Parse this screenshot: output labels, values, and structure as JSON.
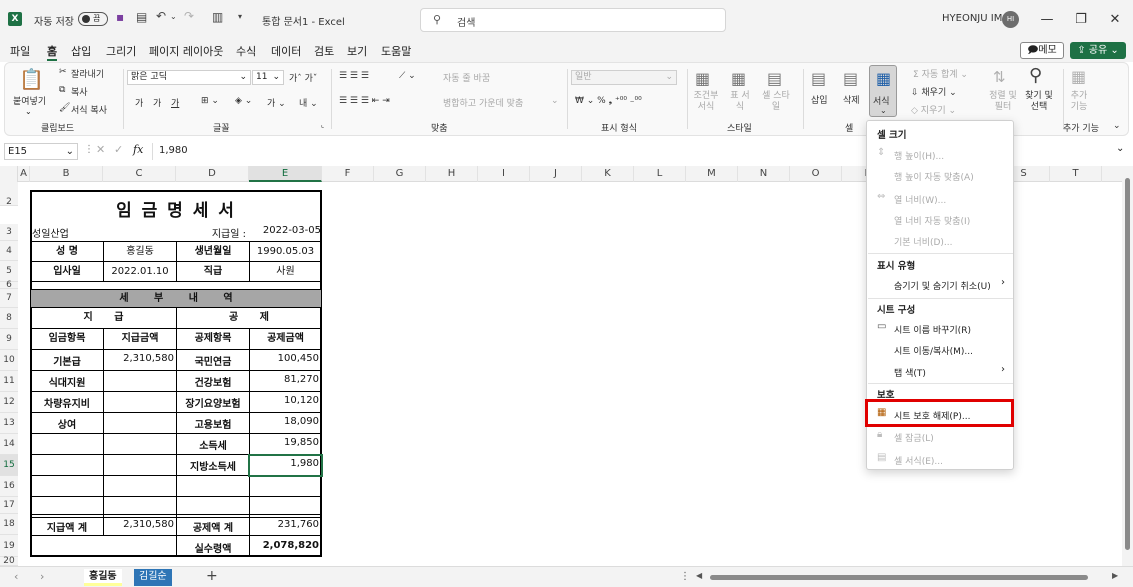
{
  "titlebar": {
    "autosave_label": "자동 저장",
    "autosave_state": "끔",
    "doc_title": "통합 문서1 - Excel",
    "search_placeholder": "검색",
    "user_name": "HYEONJU IM",
    "user_initials": "HI"
  },
  "menu": {
    "tabs": [
      "파일",
      "홈",
      "삽입",
      "그리기",
      "페이지 레이아웃",
      "수식",
      "데이터",
      "검토",
      "보기",
      "도움말"
    ],
    "active_index": 1,
    "memo_label": "메모",
    "share_label": "공유"
  },
  "ribbon": {
    "paste": "붙여넣기",
    "cut": "잘라내기",
    "copy": "복사",
    "format_painter": "서식 복사",
    "clipboard_group": "클립보드",
    "font_name": "맑은 고딕",
    "font_size": "11",
    "font_group": "글꼴",
    "wrap_text": "자동 줄 바꿈",
    "merge_center": "병합하고 가운데 맞춤",
    "align_group": "맞춤",
    "number_format": "일반",
    "number_group": "표시 형식",
    "conditional_format": "조건부 서식",
    "format_table": "표 서식",
    "cell_styles": "셀 스타일",
    "styles_group": "스타일",
    "insert": "삽입",
    "delete": "삭제",
    "format": "서식",
    "cells_group": "셀",
    "autosum": "자동 합계",
    "fill": "채우기",
    "clear": "지우기",
    "sort_filter": "정렬 및 필터",
    "find_select": "찾기 및 선택",
    "addins": "추가 기능",
    "addins_group": "추가 기능"
  },
  "formula_bar": {
    "name_box": "E15",
    "fx": "fx",
    "value": "1,980"
  },
  "grid": {
    "columns": [
      "A",
      "B",
      "C",
      "D",
      "E",
      "F",
      "G",
      "H",
      "I",
      "J",
      "K",
      "L",
      "M",
      "N",
      "O",
      "P",
      "Q",
      "R",
      "S",
      "T"
    ],
    "rows": [
      "2",
      "3",
      "4",
      "5",
      "6",
      "7",
      "8",
      "9",
      "10",
      "11",
      "12",
      "13",
      "14",
      "15",
      "16",
      "17",
      "18",
      "19",
      "20"
    ],
    "selected_column": "E",
    "selected_row": "15"
  },
  "sheet": {
    "title": "임 금 명 세 서",
    "company": "성일산업",
    "pay_date_label": "지급일 :",
    "pay_date": "2022-03-05",
    "name_label": "성 명",
    "name": "홍길동",
    "birth_label": "생년월일",
    "birth": "1990.05.03",
    "join_label": "입사일",
    "join": "2022.01.10",
    "rank_label": "직급",
    "rank": "사원",
    "details_header": "세 부 내 역",
    "pay_header": "지 급",
    "deduct_header": "공 제",
    "pay_item_h": "임금항목",
    "pay_amt_h": "지급금액",
    "ded_item_h": "공제항목",
    "ded_amt_h": "공제금액",
    "pay_items": [
      "기본급",
      "식대지원",
      "차량유지비",
      "상여"
    ],
    "pay_amounts": [
      "2,310,580",
      "",
      "",
      ""
    ],
    "ded_items": [
      "국민연금",
      "건강보험",
      "장기요양보험",
      "고용보험",
      "소득세",
      "지방소득세"
    ],
    "ded_amounts": [
      "100,450",
      "81,270",
      "10,120",
      "18,090",
      "19,850",
      "1,980"
    ],
    "pay_total_label": "지급액 계",
    "pay_total": "2,310,580",
    "ded_total_label": "공제액 계",
    "ded_total": "231,760",
    "net_label": "실수령액",
    "net": "2,078,820"
  },
  "context_menu": {
    "cell_size": "셀 크기",
    "row_height": "행 높이(H)...",
    "autofit_row": "행 높이 자동 맞춤(A)",
    "col_width": "열 너비(W)...",
    "autofit_col": "열 너비 자동 맞춤(I)",
    "default_width": "기본 너비(D)...",
    "visibility": "표시 유형",
    "hide_unhide": "숨기기 및 숨기기 취소(U)",
    "organize": "시트 구성",
    "rename": "시트 이름 바꾸기(R)",
    "move_copy": "시트 이동/복사(M)...",
    "tab_color": "탭 색(T)",
    "protection": "보호",
    "unprotect": "시트 보호 해제(P)...",
    "lock_cell": "셀 잠금(L)",
    "format_cells": "셀 서식(E)..."
  },
  "sheets": {
    "tabs": [
      "홍길동",
      "김길순"
    ],
    "active_index": 0,
    "tab_colors": [
      "#ffff99",
      "#2e75b6"
    ]
  }
}
